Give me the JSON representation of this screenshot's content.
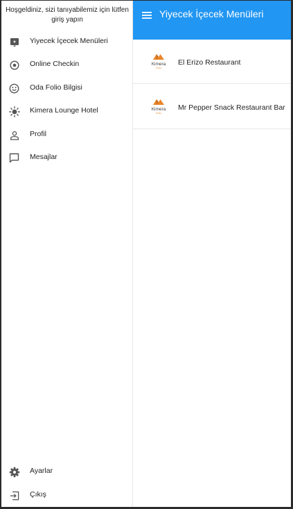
{
  "appbar": {
    "title": "Yiyecek İçecek Menüleri"
  },
  "drawer": {
    "welcome": "Hoşgeldiniz, sizi tanıyabilemiz için lütfen giriş yapın",
    "items": [
      {
        "label": "Yiyecek İçecek Menüleri",
        "icon": "restaurant-menu-icon"
      },
      {
        "label": "Online Checkin",
        "icon": "radio-target-icon"
      },
      {
        "label": "Oda Folio Bilgisi",
        "icon": "smiley-icon"
      },
      {
        "label": "Kimera Lounge Hotel",
        "icon": "sun-icon"
      },
      {
        "label": "Profil",
        "icon": "person-icon"
      },
      {
        "label": "Mesajlar",
        "icon": "message-icon"
      }
    ],
    "bottom_items": [
      {
        "label": "Ayarlar",
        "icon": "gear-icon"
      },
      {
        "label": "Çıkış",
        "icon": "logout-icon"
      }
    ]
  },
  "restaurants": [
    {
      "name": "El Erizo Restaurant",
      "logo_text": "Kimera",
      "logo_sub": "HOTEL"
    },
    {
      "name": "Mr Pepper Snack Restaurant Bar",
      "logo_text": "Kimera",
      "logo_sub": "HOTEL"
    }
  ],
  "colors": {
    "primary": "#2196f3",
    "logo_orange": "#e8862a",
    "logo_dark": "#3d3d3d"
  }
}
